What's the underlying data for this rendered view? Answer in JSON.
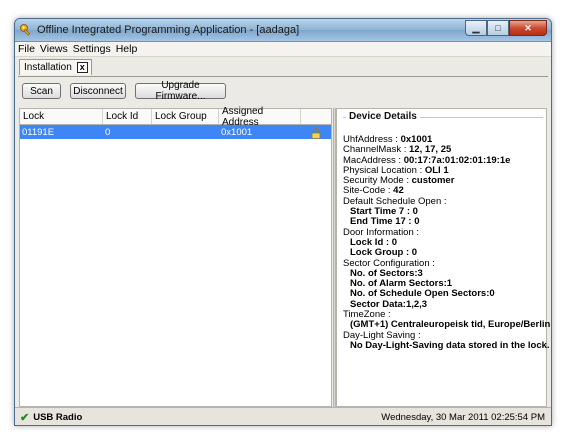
{
  "window": {
    "title": "Offline Integrated Programming Application - [aadaga]",
    "controls": {
      "minimize": "▁",
      "maximize": "□",
      "close": "✕"
    }
  },
  "menu": [
    "File",
    "Views",
    "Settings",
    "Help"
  ],
  "tabs": [
    {
      "label": "Installation",
      "close": "x"
    }
  ],
  "toolbar": {
    "scan": "Scan",
    "disconnect": "Disconnect",
    "upgrade": "Upgrade Firmware..."
  },
  "grid": {
    "columns": [
      "Lock",
      "Lock Id",
      "Lock Group",
      "Assigned Address"
    ],
    "rows": [
      {
        "lock": "01191E",
        "lock_id": "0",
        "lock_group": "",
        "assigned_address": "0x1001",
        "icon": "lock-icon",
        "selected": true
      }
    ]
  },
  "details": {
    "title": "Device Details",
    "lines": [
      {
        "label": "UhfAddress : ",
        "value": "0x1001",
        "indent": 0
      },
      {
        "label": "ChannelMask : ",
        "value": "12, 17, 25",
        "indent": 0
      },
      {
        "label": "MacAddress : ",
        "value": "00:17:7a:01:02:01:19:1e",
        "indent": 0
      },
      {
        "label": "Physical Location : ",
        "value": "OLI 1",
        "indent": 0
      },
      {
        "label": "Security Mode : ",
        "value": "customer",
        "indent": 0
      },
      {
        "label": "Site-Code : ",
        "value": "42",
        "indent": 0
      },
      {
        "label": "Default Schedule Open :",
        "value": "",
        "indent": 0
      },
      {
        "label": "",
        "value": "Start Time 7 : 0",
        "indent": 1
      },
      {
        "label": "",
        "value": "End Time 17 : 0",
        "indent": 1
      },
      {
        "label": "Door Information :",
        "value": "",
        "indent": 0
      },
      {
        "label": "",
        "value": "Lock Id : 0",
        "indent": 1
      },
      {
        "label": "",
        "value": "Lock Group : 0",
        "indent": 1
      },
      {
        "label": "Sector Configuration :",
        "value": "",
        "indent": 0
      },
      {
        "label": "",
        "value": "No. of Sectors:3",
        "indent": 1
      },
      {
        "label": "",
        "value": "No. of Alarm Sectors:1",
        "indent": 1
      },
      {
        "label": "",
        "value": "No. of Schedule Open Sectors:0",
        "indent": 1
      },
      {
        "label": "",
        "value": "Sector Data:1,2,3",
        "indent": 1
      },
      {
        "label": "TimeZone :",
        "value": "",
        "indent": 0
      },
      {
        "label": "",
        "value": "(GMT+1) Centraleuropeisk tid, Europe/Berlin",
        "indent": 1
      },
      {
        "label": "Day-Light Saving :",
        "value": "",
        "indent": 0
      },
      {
        "label": "",
        "value": "No Day-Light-Saving data stored in the lock.",
        "indent": 1
      }
    ]
  },
  "status": {
    "check": "✔",
    "connection": "USB Radio",
    "datetime": "Wednesday, 30 Mar 2011 02:25:54 PM"
  },
  "colors": {
    "selection": "#3e86f5",
    "titlebar": "#8fb2d3",
    "close_button": "#c8452c"
  }
}
